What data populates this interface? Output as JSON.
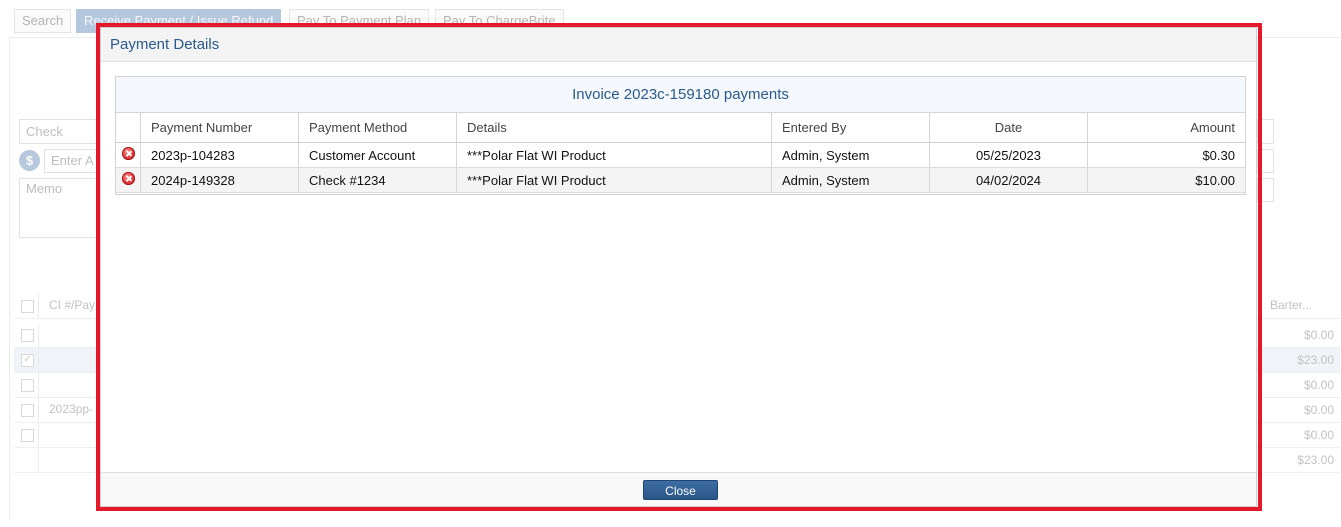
{
  "background": {
    "tabs": [
      "Search",
      "Receive Payment / Issue Refund",
      "Pay To Payment Plan",
      "Pay To ChargeBrite"
    ],
    "check_field": "Check",
    "amount_placeholder": "Enter A",
    "memo_placeholder": "Memo",
    "grid_header_left": "CI #/Pay",
    "grid_header_right": "Barter...",
    "grid_rows": [
      {
        "ref": "",
        "amount": "$0.00",
        "checked": false
      },
      {
        "ref": "",
        "amount": "$23.00",
        "checked": true
      },
      {
        "ref": "",
        "amount": "$0.00",
        "checked": false
      },
      {
        "ref": "2023pp-",
        "amount": "$0.00",
        "checked": false
      },
      {
        "ref": "",
        "amount": "$0.00",
        "checked": false
      }
    ],
    "grid_total": "$23.00"
  },
  "modal": {
    "title": "Payment Details",
    "table_caption": "Invoice 2023c-159180 payments",
    "columns": [
      "Payment Number",
      "Payment Method",
      "Details",
      "Entered By",
      "Date",
      "Amount"
    ],
    "rows": [
      {
        "payment_number": "2023p-104283",
        "payment_method": "Customer Account",
        "details": "***Polar Flat WI Product",
        "entered_by": "Admin, System",
        "date": "05/25/2023",
        "amount": "$0.30"
      },
      {
        "payment_number": "2024p-149328",
        "payment_method": "Check #1234",
        "details": "***Polar Flat WI Product",
        "entered_by": "Admin, System",
        "date": "04/02/2024",
        "amount": "$10.00"
      }
    ],
    "close_label": "Close"
  },
  "icons": {
    "delete": "delete-circle-icon",
    "dollar": "dollar-icon"
  },
  "colors": {
    "highlight": "#e3182b",
    "accent": "#2a5a8c",
    "button": "#2f5d90"
  }
}
